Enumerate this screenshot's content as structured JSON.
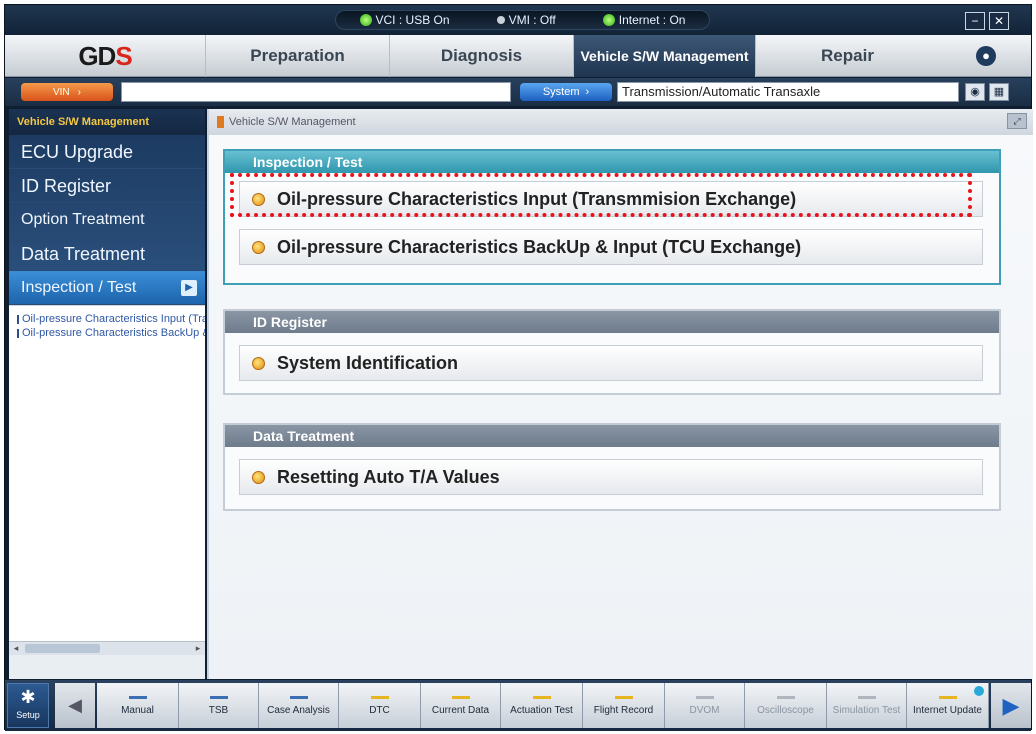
{
  "status": {
    "vci": "VCI : USB On",
    "vmi": "VMI : Off",
    "internet": "Internet : On"
  },
  "window_controls": {
    "minimize": "−",
    "close": "✕"
  },
  "logo": {
    "text_main": "GD",
    "text_accent": "S"
  },
  "tabs": [
    "Preparation",
    "Diagnosis",
    "Vehicle S/W Management",
    "Repair"
  ],
  "active_tab": "Vehicle S/W Management",
  "search_icon": "search-icon",
  "vin_bar": {
    "vin_button": "VIN",
    "system_button": "System",
    "system_value": "Transmission/Automatic Transaxle"
  },
  "sidebar": {
    "header": "Vehicle S/W Management",
    "items": [
      {
        "label": "ECU Upgrade"
      },
      {
        "label": "ID Register"
      },
      {
        "label": "Option Treatment"
      },
      {
        "label": "Data Treatment"
      },
      {
        "label": "Inspection / Test"
      }
    ],
    "active_item": "Inspection / Test",
    "tree": [
      "Oil-pressure  Characteristics Input (Transmmision Exchange)",
      "Oil-pressure  Characteristics BackUp & Input (TCU Exchange)"
    ]
  },
  "main": {
    "header": "Vehicle S/W Management",
    "groups": [
      {
        "title": "Inspection / Test",
        "items": [
          "Oil-pressure Characteristics Input (Transmmision Exchange)",
          "Oil-pressure Characteristics BackUp & Input (TCU Exchange)"
        ]
      },
      {
        "title": "ID Register",
        "items": [
          "System Identification"
        ]
      },
      {
        "title": "Data Treatment",
        "items": [
          "Resetting Auto T/A Values"
        ]
      }
    ],
    "highlighted_item": "Oil-pressure Characteristics Input (Transmmision Exchange)"
  },
  "toolbar": {
    "setup": "Setup",
    "buttons": [
      {
        "label": "Manual",
        "enabled": true
      },
      {
        "label": "TSB",
        "enabled": true
      },
      {
        "label": "Case Analysis",
        "enabled": true
      },
      {
        "label": "DTC",
        "enabled": true
      },
      {
        "label": "Current Data",
        "enabled": true
      },
      {
        "label": "Actuation Test",
        "enabled": true
      },
      {
        "label": "Flight Record",
        "enabled": true
      },
      {
        "label": "DVOM",
        "enabled": false
      },
      {
        "label": "Oscilloscope",
        "enabled": false
      },
      {
        "label": "Simulation Test",
        "enabled": false
      },
      {
        "label": "Internet Update",
        "enabled": true
      }
    ]
  },
  "colors": {
    "accent_blue": "#1d64ac",
    "highlight_red": "#e8141a",
    "group_teal": "#3f9fb6",
    "brand_red": "#d9261c"
  }
}
